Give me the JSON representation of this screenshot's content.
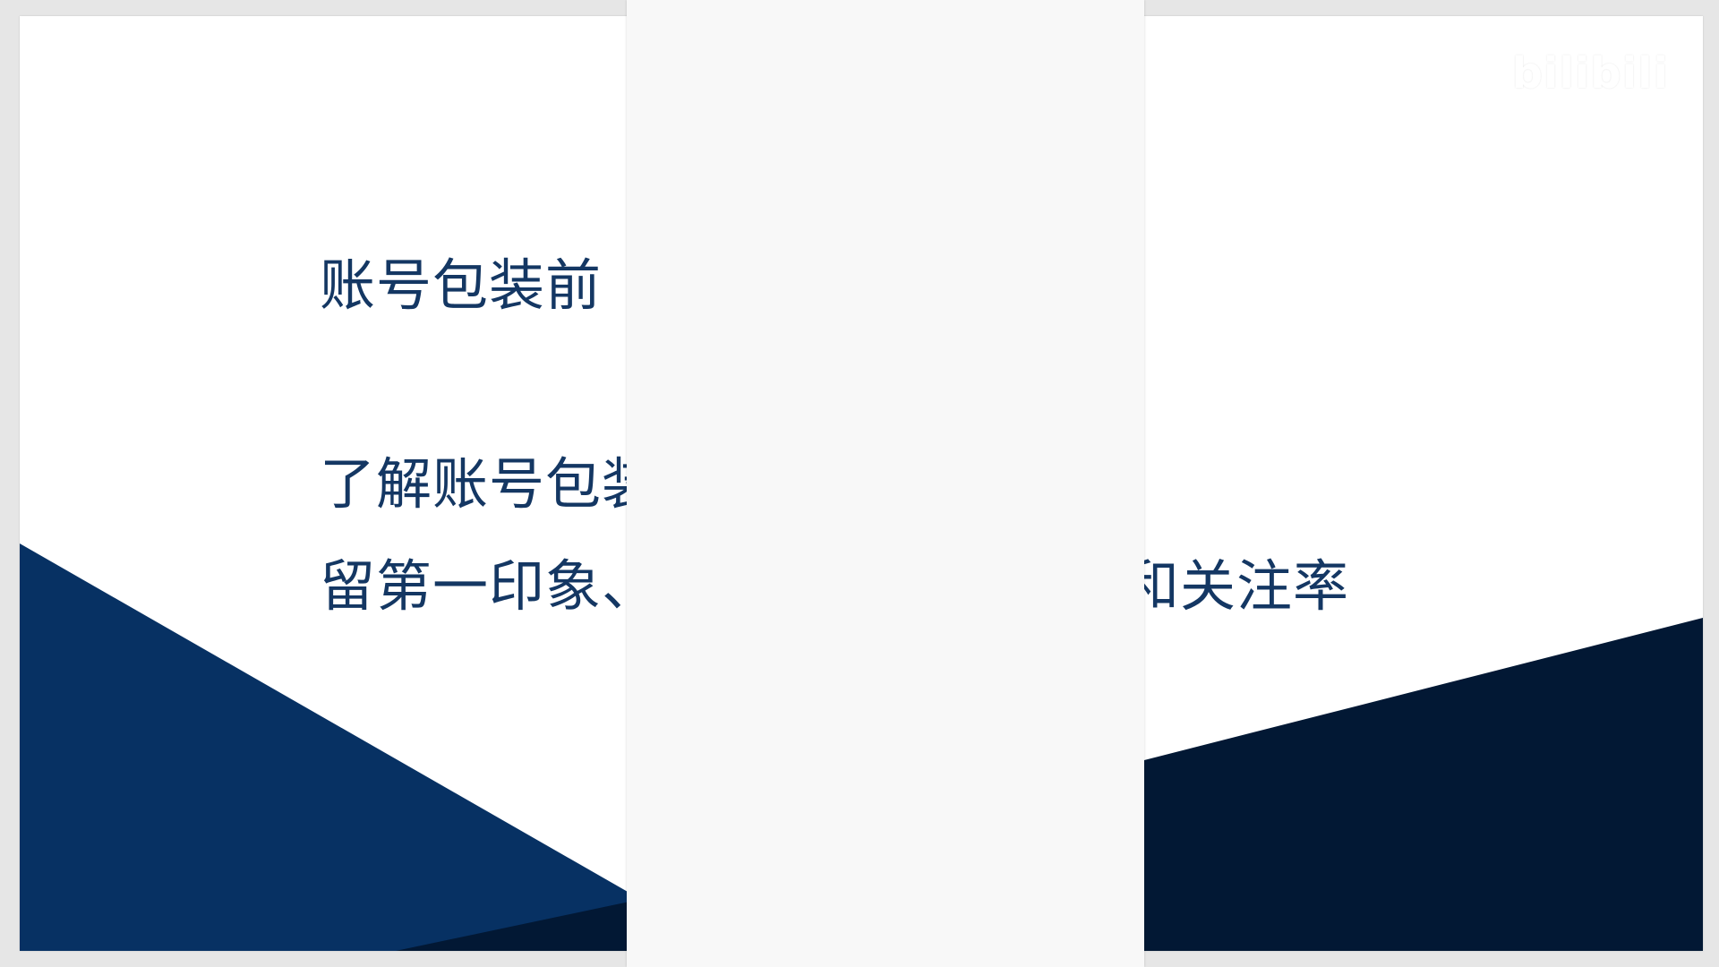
{
  "slide": {
    "title": "账号包装前",
    "line_1": "了解账号包装",
    "line_2": "留第一印象、",
    "line_2_tail": "和关注率"
  },
  "watermark": {
    "text": "bilibili"
  },
  "colors": {
    "background": "#e6e6e6",
    "slide_bg": "#ffffff",
    "text": "#143763",
    "navy_left": "#073163",
    "navy_dark": "#021834",
    "overlay_panel": "#f8f8f8"
  }
}
